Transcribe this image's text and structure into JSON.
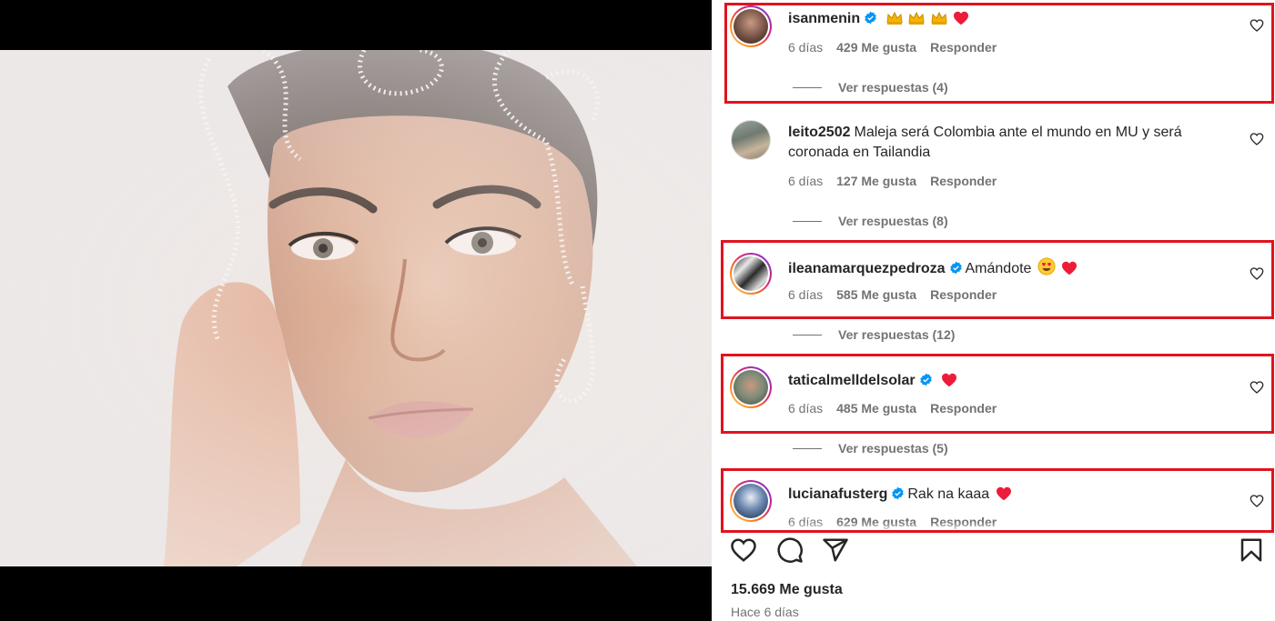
{
  "post": {
    "likes": "15.669 Me gusta",
    "date": "Hace 6 días"
  },
  "comments": [
    {
      "username": "isanmenin",
      "verified": true,
      "text": "",
      "time": "6 días",
      "likes": "429 Me gusta",
      "reply": "Responder",
      "view_replies": "Ver respuestas (4)"
    },
    {
      "username": "leito2502",
      "verified": false,
      "text": "Maleja será Colombia ante el mundo en MU y será coronada en Tailandia",
      "time": "6 días",
      "likes": "127 Me gusta",
      "reply": "Responder",
      "view_replies": "Ver respuestas (8)"
    },
    {
      "username": "ileanamarquezpedroza",
      "verified": true,
      "text": "Amándote",
      "time": "6 días",
      "likes": "585 Me gusta",
      "reply": "Responder",
      "view_replies": "Ver respuestas (12)"
    },
    {
      "username": "taticalmelldelsolar",
      "verified": true,
      "text": "",
      "time": "6 días",
      "likes": "485 Me gusta",
      "reply": "Responder",
      "view_replies": "Ver respuestas (5)"
    },
    {
      "username": "lucianafusterg",
      "verified": true,
      "text": "Rak na kaaa",
      "time": "6 días",
      "likes": "629 Me gusta",
      "reply": "Responder"
    }
  ],
  "colors": {
    "highlight": "#e0131f",
    "verified": "#0095f6",
    "heart": "#ed1c3a",
    "muted": "#737373"
  },
  "icons": [
    "like-icon",
    "comment-icon",
    "share-icon",
    "save-icon",
    "verified-icon",
    "crown-emoji",
    "red-heart-emoji",
    "heart-eyes-emoji"
  ]
}
